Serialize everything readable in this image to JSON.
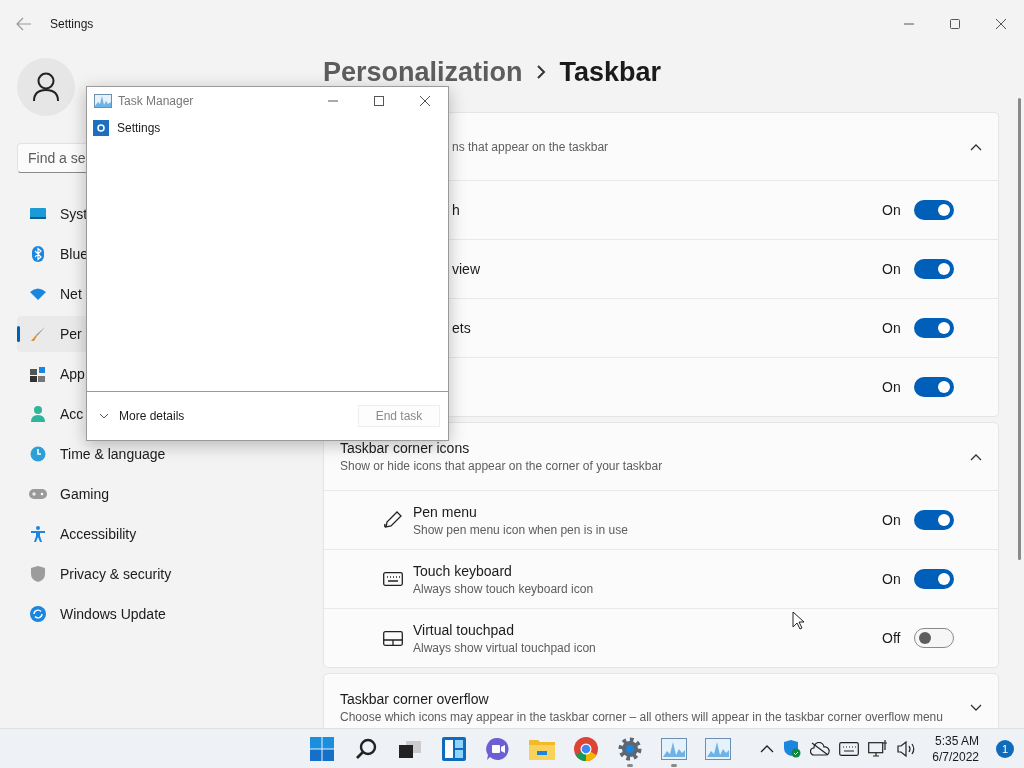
{
  "window": {
    "title": "Settings"
  },
  "search": {
    "placeholder": "Find a se"
  },
  "sidebar": {
    "items": [
      {
        "label": "Syst",
        "selected": false
      },
      {
        "label": "Blue",
        "selected": false
      },
      {
        "label": "Net",
        "selected": false
      },
      {
        "label": "Per",
        "selected": true
      },
      {
        "label": "App",
        "selected": false
      },
      {
        "label": "Acc",
        "selected": false
      },
      {
        "label": "Time & language",
        "selected": false
      },
      {
        "label": "Gaming",
        "selected": false
      },
      {
        "label": "Accessibility",
        "selected": false
      },
      {
        "label": "Privacy & security",
        "selected": false
      },
      {
        "label": "Windows Update",
        "selected": false
      }
    ]
  },
  "breadcrumb": {
    "parent": "Personalization",
    "current": "Taskbar"
  },
  "sections": [
    {
      "description": "ns that appear on the taskbar",
      "expanded": true,
      "rows": [
        {
          "label": "h",
          "status": "On",
          "on": true
        },
        {
          "label": "view",
          "status": "On",
          "on": true
        },
        {
          "label": "ets",
          "status": "On",
          "on": true
        },
        {
          "status": "On",
          "on": true
        }
      ]
    },
    {
      "title": "Taskbar corner icons",
      "description": "Show or hide icons that appear on the corner of your taskbar",
      "expanded": true,
      "rows": [
        {
          "label": "Pen menu",
          "description": "Show pen menu icon when pen is in use",
          "status": "On",
          "on": true
        },
        {
          "label": "Touch keyboard",
          "description": "Always show touch keyboard icon",
          "status": "On",
          "on": true
        },
        {
          "label": "Virtual touchpad",
          "description": "Always show virtual touchpad icon",
          "status": "Off",
          "on": false
        }
      ]
    },
    {
      "title": "Taskbar corner overflow",
      "description": "Choose which icons may appear in the taskbar corner – all others will appear in the taskbar corner overflow menu",
      "expanded": false
    }
  ],
  "task_manager": {
    "title": "Task Manager",
    "apps": [
      {
        "name": "Settings"
      }
    ],
    "more_details": "More details",
    "end_task": {
      "label": "End task",
      "disabled": true
    }
  },
  "taskbar": {
    "apps": [
      {
        "running": false
      },
      {
        "running": false
      },
      {
        "running": false
      },
      {
        "running": false
      },
      {
        "running": false
      },
      {
        "running": false
      },
      {
        "running": false
      },
      {
        "running": true
      },
      {
        "running": true
      },
      {
        "running": false
      }
    ],
    "clock": {
      "time": "5:35 AM",
      "date": "6/7/2022"
    },
    "notifications": "1"
  }
}
